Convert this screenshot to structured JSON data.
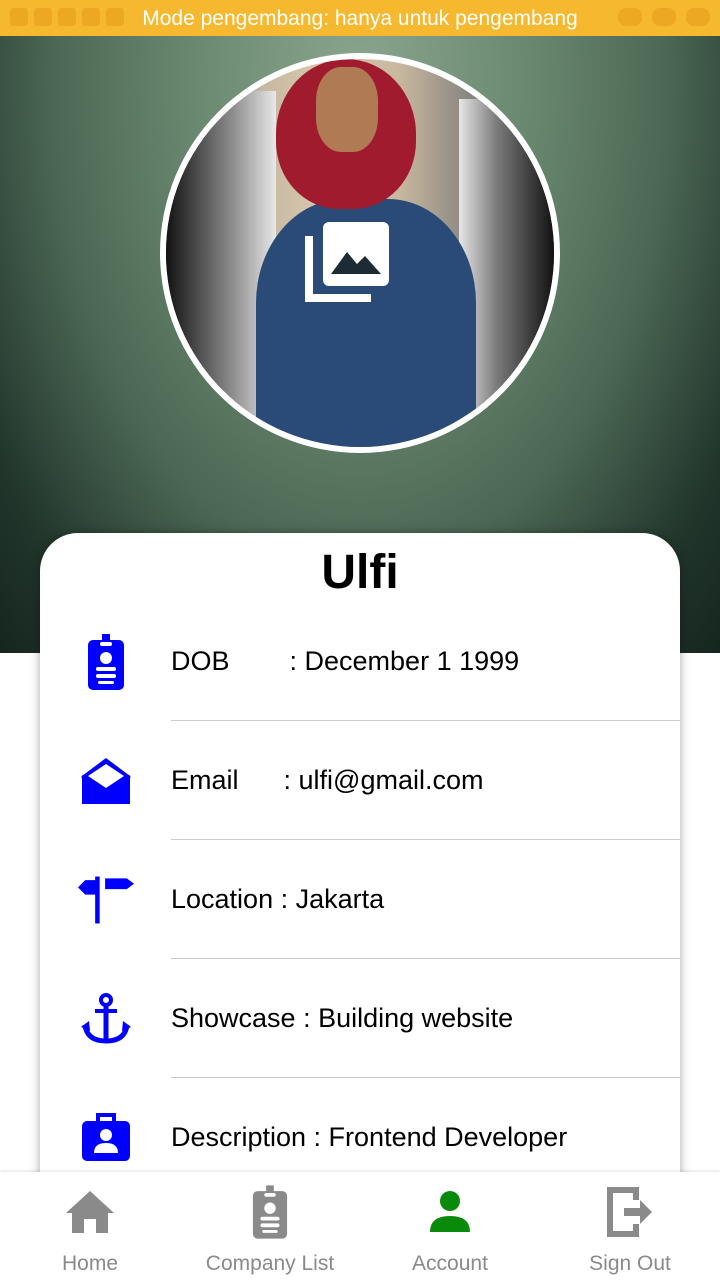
{
  "status_bar": {
    "text": "Mode pengembang: hanya untuk pengembang"
  },
  "profile": {
    "name": "Ulfi",
    "avatar_badge_icon": "gallery-icon",
    "rows": [
      {
        "icon": "id-badge-icon",
        "label": "DOB        : December 1 1999"
      },
      {
        "icon": "envelope-open-icon",
        "label": "Email      : ulfi@gmail.com"
      },
      {
        "icon": "signpost-icon",
        "label": "Location : Jakarta"
      },
      {
        "icon": "anchor-icon",
        "label": "Showcase : Building website"
      },
      {
        "icon": "briefcase-user-icon",
        "label": "Description : Frontend Developer"
      }
    ]
  },
  "bottom_nav": {
    "items": [
      {
        "label": "Home",
        "icon": "home-icon",
        "active": false
      },
      {
        "label": "Company List",
        "icon": "id-badge-icon",
        "active": false
      },
      {
        "label": "Account",
        "icon": "person-icon",
        "active": true
      },
      {
        "label": "Sign Out",
        "icon": "exit-icon",
        "active": false
      }
    ]
  },
  "colors": {
    "accent_blue": "#0000ff",
    "active_green": "#0a8a0a",
    "inactive_gray": "#8a8a8a",
    "status_bar": "#f5b82e"
  }
}
